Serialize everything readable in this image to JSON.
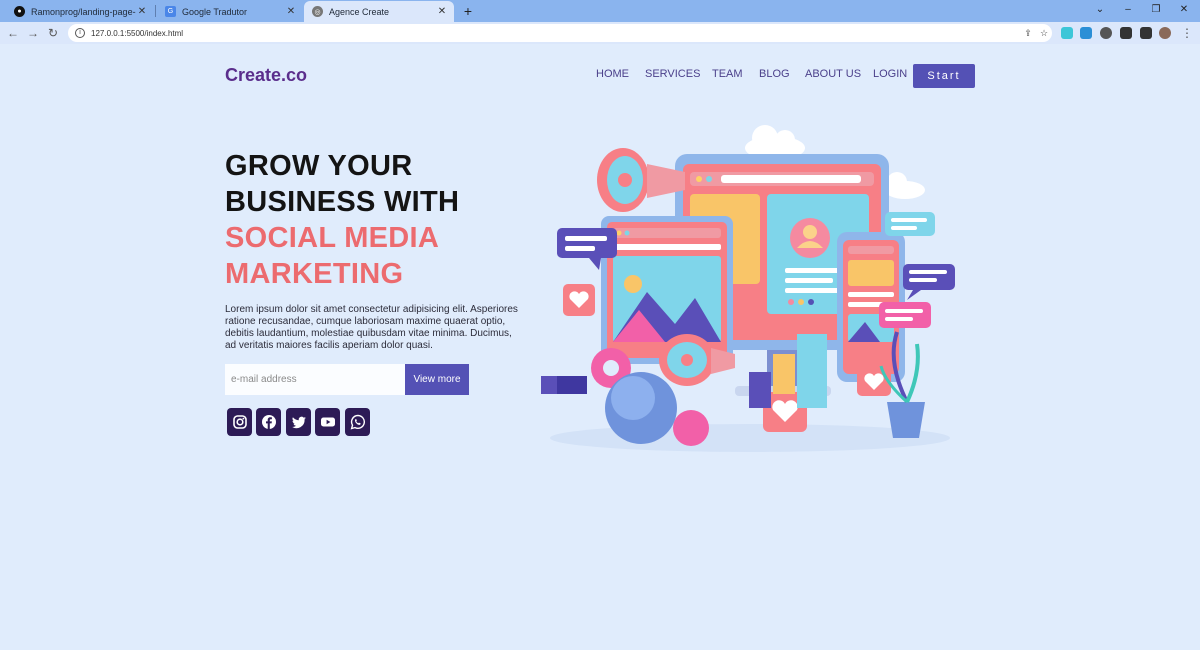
{
  "browser": {
    "tabs": [
      {
        "title": "Ramonprog/landing-page-respo",
        "icon": "github-icon",
        "state": "inactive"
      },
      {
        "title": "Google Tradutor",
        "icon": "google-translate-icon",
        "state": "inactive"
      },
      {
        "title": "Agence Create",
        "icon": "globe-icon",
        "state": "active"
      }
    ],
    "new_tab_label": "+",
    "url": "127.0.0.1:5500/index.html"
  },
  "header": {
    "logo": "Create.co",
    "nav": [
      "HOME",
      "SERVICES",
      "TEAM",
      "BLOG",
      "ABOUT US",
      "LOGIN"
    ],
    "start_label": "Start"
  },
  "hero": {
    "title_line1": "GROW YOUR",
    "title_line2": "BUSINESS WITH",
    "title_line3": "SOCIAL MEDIA",
    "title_line4": "MARKETING",
    "text": "Lorem ipsum dolor sit amet consectetur adipisicing elit. Asperiores ratione recusandae, cumque laboriosam maxime quaerat optio, debitis laudantium, molestiae quibusdam vitae minima. Ducimus, ad veritatis maiores facilis aperiam dolor quasi.",
    "email_placeholder": "e-mail address",
    "button_label": "View more"
  },
  "social": [
    "instagram-icon",
    "facebook-icon",
    "twitter-icon",
    "youtube-icon",
    "whatsapp-icon"
  ],
  "colors": {
    "background": "#e0ecfc",
    "primary": "#5451b5",
    "logo": "#5b2e8c",
    "accent": "#ec6b6f",
    "social_bg": "#2d1b56"
  }
}
